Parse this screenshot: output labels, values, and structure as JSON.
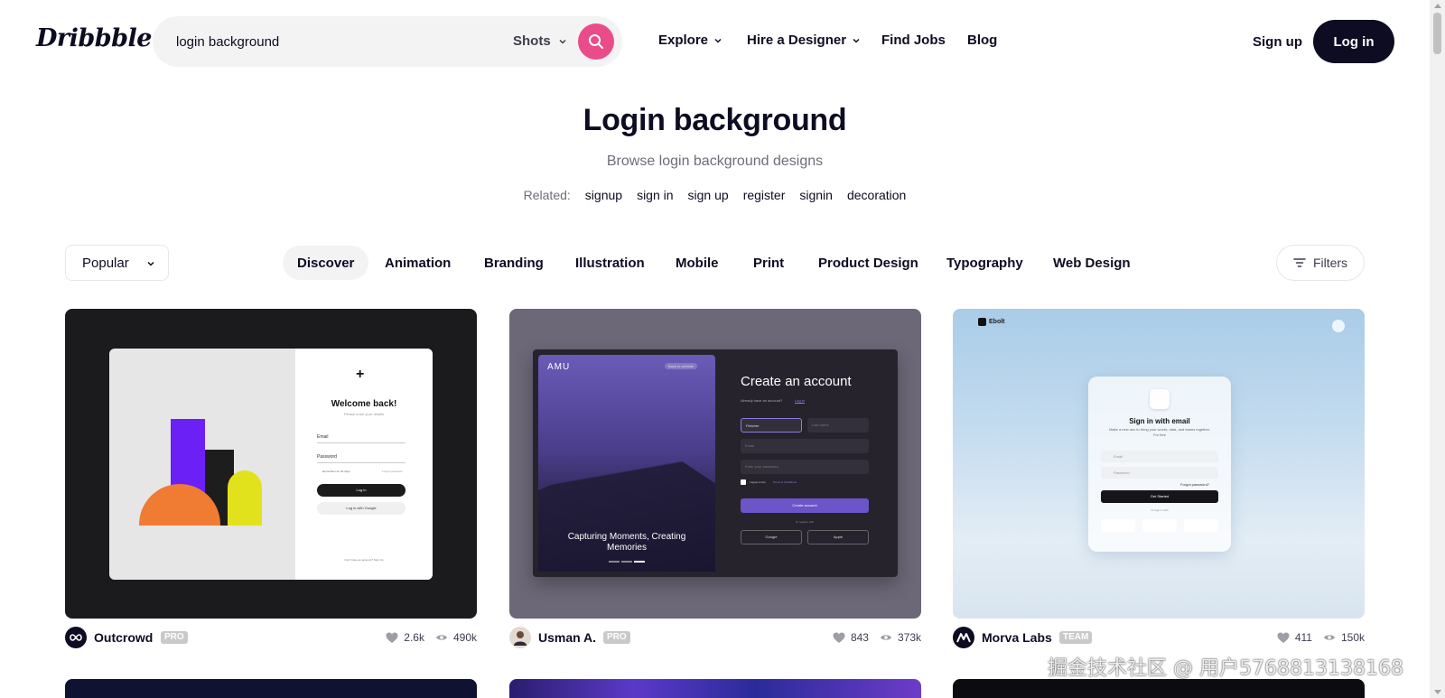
{
  "header": {
    "logo": "Dribbble",
    "search": {
      "value": "login background",
      "type_label": "Shots"
    },
    "nav": {
      "explore": "Explore",
      "hire": "Hire a Designer",
      "jobs": "Find Jobs",
      "blog": "Blog"
    },
    "signup": "Sign up",
    "login": "Log in"
  },
  "page": {
    "title": "Login background",
    "subtitle": "Browse login background designs",
    "related_label": "Related:",
    "related": [
      "signup",
      "sign in",
      "sign up",
      "register",
      "signin",
      "decoration"
    ]
  },
  "filters": {
    "sort": "Popular",
    "categories": [
      "Discover",
      "Animation",
      "Branding",
      "Illustration",
      "Mobile",
      "Print",
      "Product Design",
      "Typography",
      "Web Design"
    ],
    "active_category": "Discover",
    "filters_label": "Filters"
  },
  "shots": [
    {
      "author": "Outcrowd",
      "badge": "PRO",
      "likes": "2.6k",
      "views": "490k",
      "mock": {
        "title": "Welcome back!",
        "subtitle": "Please enter your details",
        "email": "Email",
        "password": "Password",
        "remember": "Remember for 30 days",
        "forgot": "Forgot password",
        "login": "Log in",
        "google": "Log in with Google",
        "footer": "Don't have an account? Sign Up"
      }
    },
    {
      "author": "Usman A.",
      "badge": "PRO",
      "likes": "843",
      "views": "373k",
      "mock": {
        "brand": "AMU",
        "back": "Back to website",
        "caption": "Capturing Moments, Creating Memories",
        "title": "Create an account",
        "have_account": "Already have an account?",
        "login_link": "Log in",
        "first": "Fletcher",
        "last": "Last name",
        "email": "Email",
        "password": "Enter your password",
        "agree": "I agree to the",
        "terms": "Terms & Conditions",
        "create": "Create account",
        "or": "Or register with",
        "google": "Google",
        "apple": "Apple"
      }
    },
    {
      "author": "Morva Labs",
      "badge": "TEAM",
      "likes": "411",
      "views": "150k",
      "mock": {
        "brand": "Ebolt",
        "title": "Sign in with email",
        "desc": "Make a new doc to bring your words, data, and teams together. For free",
        "email": "Email",
        "password": "Password",
        "forgot": "Forgot password?",
        "start": "Get Started",
        "or": "Or sign in with"
      }
    }
  ],
  "watermark": "掘金技术社区 @ 用户5768813138168",
  "colors": {
    "accent": "#ea4c89",
    "dark": "#0d0c22",
    "muted": "#6e6d7a"
  }
}
